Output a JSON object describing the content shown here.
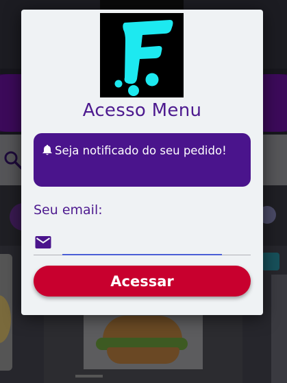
{
  "modal": {
    "logo_letter": "F",
    "title": "Acesso Menu",
    "notice_text": "Seja notificado do seu pedido!",
    "email_label": "Seu email:",
    "email_value": "",
    "submit_label": "Acessar"
  },
  "icons": {
    "notice": "bell-icon",
    "email": "mail-icon",
    "search": "search-icon",
    "expand": "expand-icon"
  },
  "colors": {
    "primary_purple": "#4a148c",
    "title_purple": "#4d1a8f",
    "submit_red": "#c8002e",
    "logo_cyan": "#1de9f0",
    "input_focus": "#4a5ed6"
  }
}
